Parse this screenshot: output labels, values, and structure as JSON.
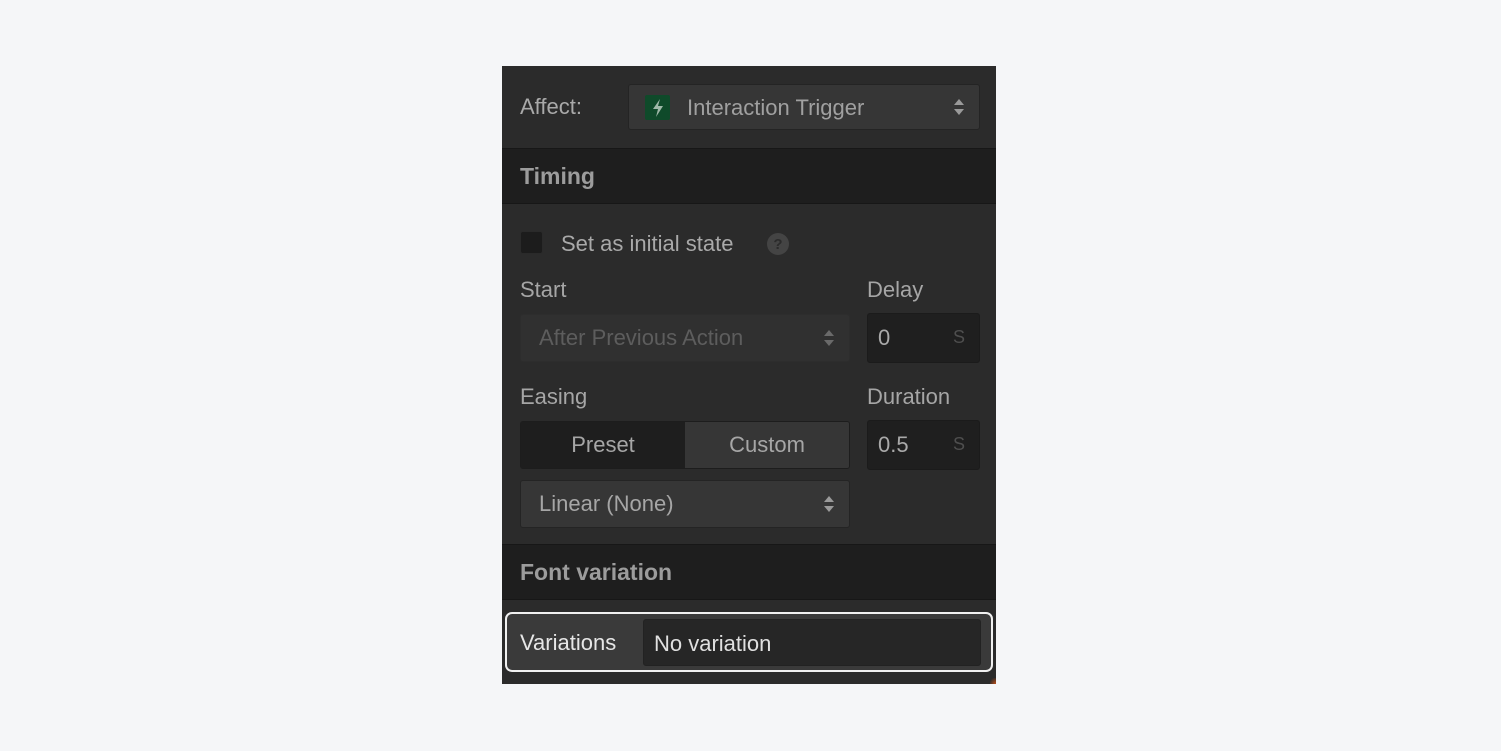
{
  "affect": {
    "label": "Affect:",
    "value": "Interaction Trigger",
    "icon": "lightning-bolt-icon",
    "icon_bg_color": "#0f4a2a"
  },
  "timing": {
    "section_title": "Timing",
    "initial_state_label": "Set as initial state",
    "initial_state_checked": false,
    "help_icon": "?",
    "start_label": "Start",
    "start_value": "After Previous Action",
    "delay_label": "Delay",
    "delay_value": "0",
    "delay_unit": "S",
    "easing_label": "Easing",
    "easing_modes": [
      "Preset",
      "Custom"
    ],
    "easing_active_mode": "Preset",
    "easing_value": "Linear (None)",
    "duration_label": "Duration",
    "duration_value": "0.5",
    "duration_unit": "S"
  },
  "font_variation": {
    "section_title": "Font variation",
    "variations_label": "Variations",
    "variations_value": "No variation"
  }
}
